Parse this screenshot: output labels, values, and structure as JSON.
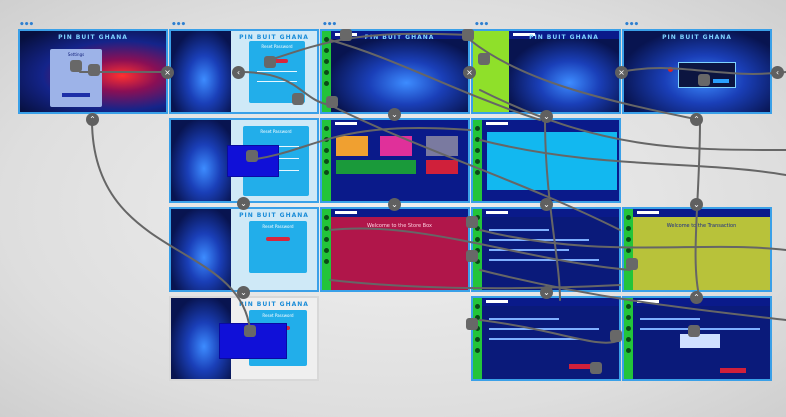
{
  "app": {
    "brand_title": "PIN BUIT GHANA",
    "frame_menu": "•••"
  },
  "screens": {
    "settings_title": "Settings",
    "reset_title": "Reset Password",
    "welcome_store": "Welcome to the Store Box",
    "welcome_trans": "Welcome to the Transaction"
  },
  "icons": {
    "collapse": "×",
    "up": "⌃",
    "down": "⌄",
    "left": "‹"
  },
  "colors": {
    "accent": "#3aa0e8",
    "sidebar_green": "#23c43a",
    "wire": "#666666"
  }
}
